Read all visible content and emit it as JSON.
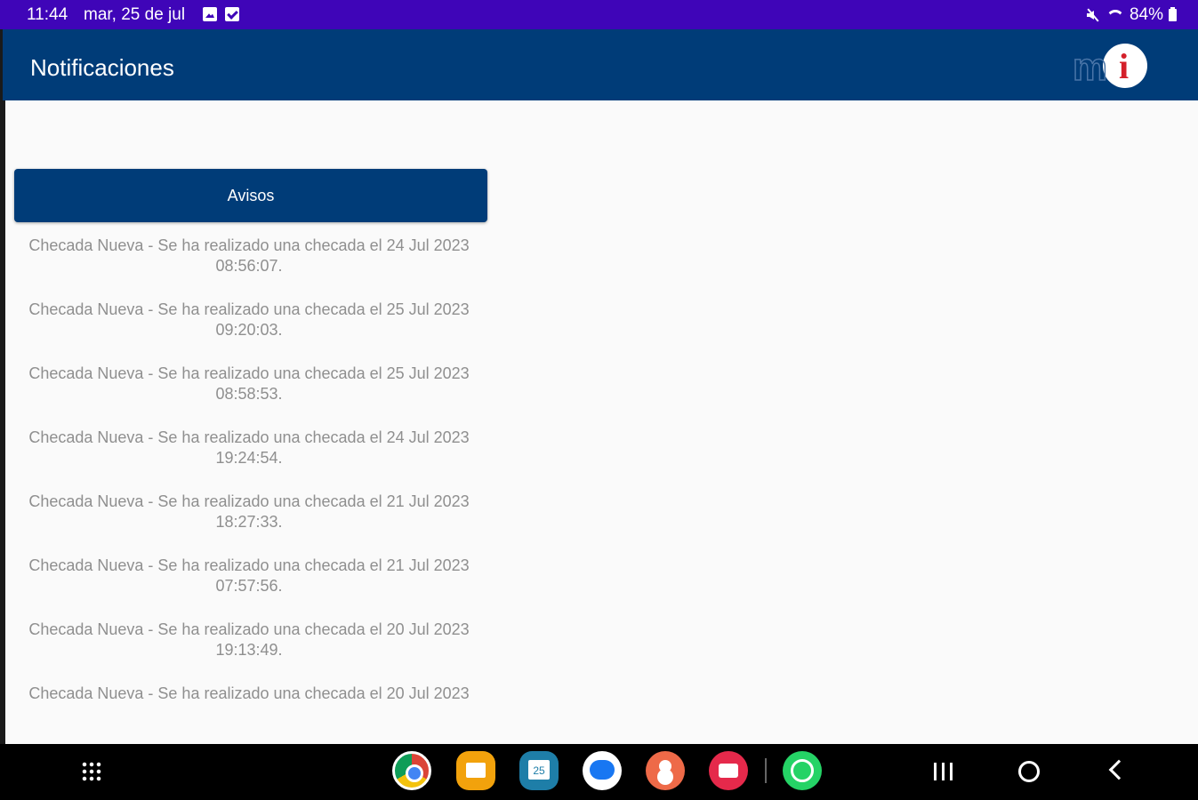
{
  "status_bar": {
    "time": "11:44",
    "date": "mar, 25 de jul",
    "battery": "84%"
  },
  "app_bar": {
    "title": "Notificaciones",
    "logo_text_m": "m",
    "logo_text_i": "i"
  },
  "section": {
    "button_label": "Avisos"
  },
  "notifications": [
    "Checada Nueva - Se ha realizado una checada el 24 Jul 2023 08:56:07.",
    "Checada Nueva - Se ha realizado una checada el 25 Jul 2023 09:20:03.",
    "Checada Nueva - Se ha realizado una checada el 25 Jul 2023 08:58:53.",
    "Checada Nueva - Se ha realizado una checada el 24 Jul 2023 19:24:54.",
    "Checada Nueva - Se ha realizado una checada el 21 Jul 2023 18:27:33.",
    "Checada Nueva - Se ha realizado una checada el 21 Jul 2023 07:57:56.",
    "Checada Nueva - Se ha realizado una checada el 20 Jul 2023 19:13:49.",
    "Checada Nueva - Se ha realizado una checada el 20 Jul 2023"
  ],
  "dock": {
    "apps": [
      "chrome-icon",
      "files-icon",
      "calendar-icon",
      "messages-icon",
      "contacts-icon",
      "camera-icon",
      "whatsapp-icon"
    ]
  },
  "colors": {
    "status_bar": "#3f05b8",
    "app_bar": "#003c78",
    "button": "#003c78",
    "notification_text": "#8f8f8f"
  }
}
